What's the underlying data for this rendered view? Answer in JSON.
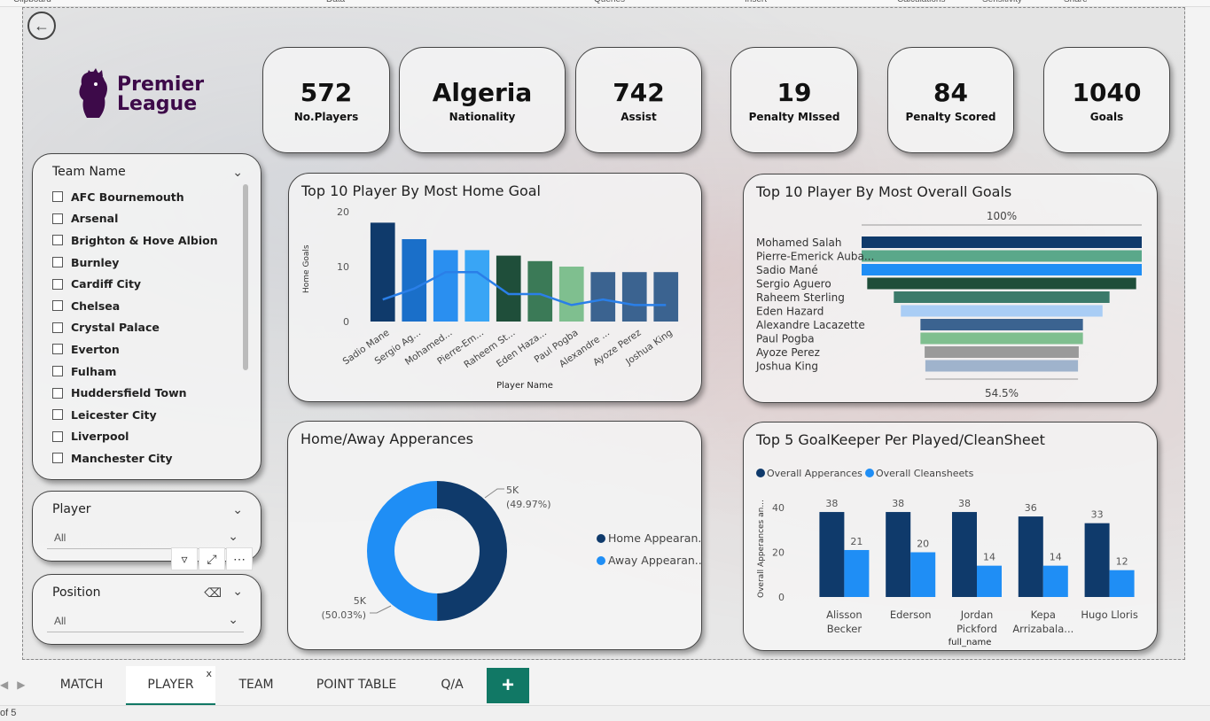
{
  "ribbon": {
    "groups": [
      "Clipboard",
      "Data",
      "Queries",
      "Insert",
      "Calculations",
      "Sensitivity",
      "Share"
    ]
  },
  "kpis": [
    {
      "value": "572",
      "label": "No.Players"
    },
    {
      "value": "Algeria",
      "label": "Nationality"
    },
    {
      "value": "742",
      "label": "Assist"
    },
    {
      "value": "19",
      "label": "Penalty MIssed"
    },
    {
      "value": "84",
      "label": "Penalty Scored"
    },
    {
      "value": "1040",
      "label": "Goals"
    }
  ],
  "logo": {
    "line1": "Premier",
    "line2": "League"
  },
  "slicers": {
    "team": {
      "header": "Team Name",
      "items": [
        "AFC Bournemouth",
        "Arsenal",
        "Brighton & Hove Albion",
        "Burnley",
        "Cardiff City",
        "Chelsea",
        "Crystal Palace",
        "Everton",
        "Fulham",
        "Huddersfield Town",
        "Leicester City",
        "Liverpool",
        "Manchester City"
      ]
    },
    "player": {
      "header": "Player",
      "value": "All"
    },
    "position": {
      "header": "Position",
      "value": "All"
    }
  },
  "chart_data": [
    {
      "type": "bar",
      "title": "Top 10 Player By Most Home Goal",
      "xlabel": "Player Name",
      "ylabel": "Home Goals",
      "categories": [
        "Sadio Mane",
        "Sergio Ag...",
        "Mohamed...",
        "Pierre-Em...",
        "Raheem St...",
        "Eden Haza...",
        "Paul Pogba",
        "Alexandre ...",
        "Ayoze Perez",
        "Joshua King"
      ],
      "values": [
        18,
        15,
        13,
        13,
        12,
        11,
        10,
        9,
        9,
        9
      ],
      "line_values": [
        4,
        6,
        9,
        9,
        5,
        5,
        3,
        4,
        3,
        3
      ],
      "colors": [
        "#0f3a6b",
        "#1a6fc9",
        "#2a8ff0",
        "#39a5f5",
        "#1f4e3a",
        "#3b7a57",
        "#7fbf8f",
        "#3b6390",
        "#3b6390",
        "#3b6390"
      ],
      "ylim": [
        0,
        20
      ],
      "yticks": [
        0,
        10,
        20
      ]
    },
    {
      "type": "bar",
      "title": "Top 10 Player By Most Overall Goals",
      "categories": [
        "Mohamed Salah",
        "Pierre-Emerick Auba...",
        "Sadio Mané",
        "Sergio Aguero",
        "Raheem Sterling",
        "Eden Hazard",
        "Alexandre Lacazette",
        "Paul Pogba",
        "Ayoze Perez",
        "Joshua King"
      ],
      "values": [
        100,
        100,
        100,
        96,
        77,
        72,
        58,
        58,
        55,
        54.5
      ],
      "colors": [
        "#0f3a6b",
        "#5aa88a",
        "#1f8ef5",
        "#1f4e3a",
        "#3b7a6a",
        "#a9cdf5",
        "#3b6390",
        "#7fbf8f",
        "#9a9a9a",
        "#9fb3cc"
      ],
      "top_label": "100%",
      "bottom_label": "54.5%"
    },
    {
      "type": "pie",
      "title": "Home/Away Apperances",
      "series": [
        {
          "name": "Home Appearan...",
          "value": 49.97,
          "label": "5K",
          "pct": "(49.97%)",
          "color": "#0f3a6b"
        },
        {
          "name": "Away Appearan...",
          "value": 50.03,
          "label": "5K",
          "pct": "(50.03%)",
          "color": "#1f8ef5"
        }
      ]
    },
    {
      "type": "bar",
      "title": "Top 5 GoalKeeper Per Played/CleanSheet",
      "xlabel": "full_name",
      "ylabel": "Overall Apperances an...",
      "categories": [
        [
          "Alisson",
          "Becker"
        ],
        [
          "Ederson"
        ],
        [
          "Jordan",
          "Pickford"
        ],
        [
          "Kepa",
          "Arrizabala..."
        ],
        [
          "Hugo Lloris"
        ]
      ],
      "series": [
        {
          "name": "Overall Apperances",
          "values": [
            38,
            38,
            38,
            36,
            33
          ],
          "color": "#0f3a6b"
        },
        {
          "name": "Overall Cleansheets",
          "values": [
            21,
            20,
            14,
            14,
            12
          ],
          "color": "#1f8ef5"
        }
      ],
      "ylim": [
        0,
        40
      ],
      "yticks": [
        0,
        20,
        40
      ]
    }
  ],
  "tabs": [
    "MATCH",
    "PLAYER",
    "TEAM",
    "POINT TABLE",
    "Q/A"
  ],
  "active_tab": "PLAYER",
  "tab_close": "x",
  "add_tab": "+",
  "status": "of 5"
}
